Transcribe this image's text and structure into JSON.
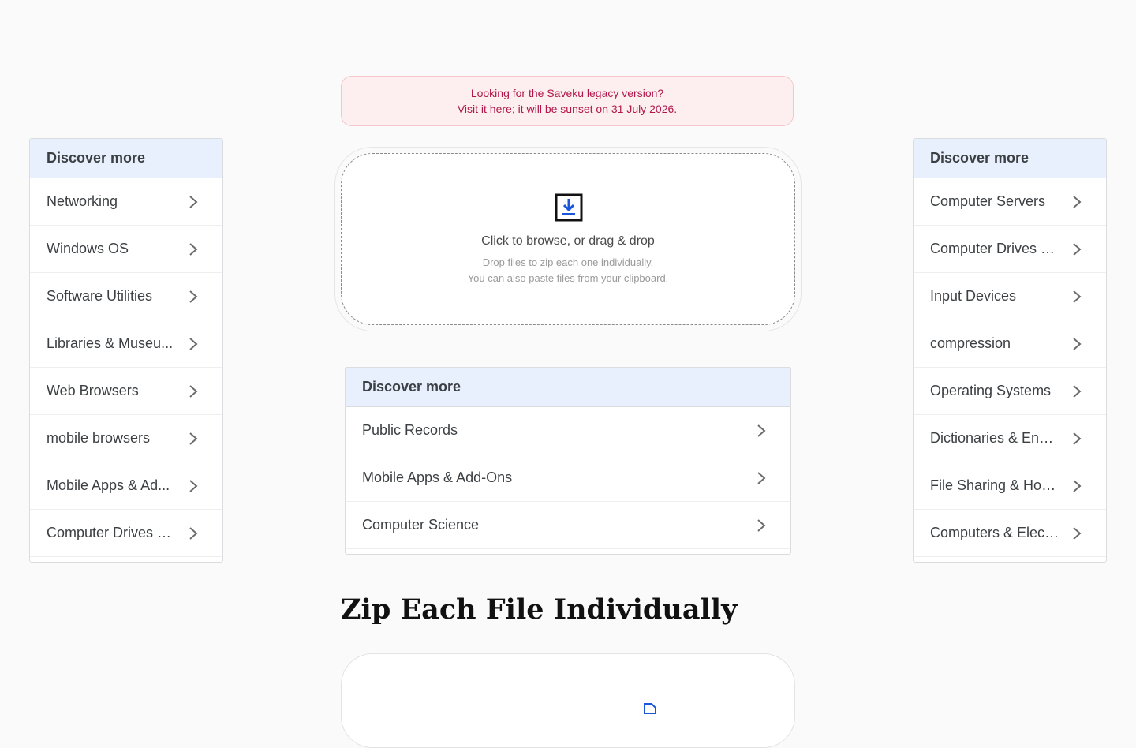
{
  "banner": {
    "line1": "Looking for the Saveku legacy version?",
    "link": "Visit it here",
    "line2_rest": "; it will be sunset on 31 July 2026."
  },
  "dropzone": {
    "title": "Click to browse, or drag & drop",
    "line1": "Drop files to zip each one individually.",
    "line2": "You can also paste files from your clipboard."
  },
  "left_panel": {
    "header": "Discover more",
    "items": [
      {
        "label": "Networking"
      },
      {
        "label": "Windows OS"
      },
      {
        "label": "Software Utilities"
      },
      {
        "label": "Libraries & Museu..."
      },
      {
        "label": "Web Browsers"
      },
      {
        "label": "mobile browsers"
      },
      {
        "label": "Mobile Apps & Ad..."
      },
      {
        "label": "Computer Drives &..."
      }
    ]
  },
  "center_panel": {
    "header": "Discover more",
    "items": [
      {
        "label": "Public Records"
      },
      {
        "label": "Mobile Apps & Add-Ons"
      },
      {
        "label": "Computer Science"
      }
    ]
  },
  "right_panel": {
    "header": "Discover more",
    "items": [
      {
        "label": "Computer Servers"
      },
      {
        "label": "Computer Drives &..."
      },
      {
        "label": "Input Devices"
      },
      {
        "label": "compression"
      },
      {
        "label": "Operating Systems"
      },
      {
        "label": "Dictionaries & Ency..."
      },
      {
        "label": "File Sharing & Host..."
      },
      {
        "label": "Computers & Elect..."
      }
    ]
  },
  "page": {
    "heading": "Zip Each File Individually"
  },
  "icons": {
    "dropzone": "download-tray-icon",
    "chevron": "chevron-right-icon",
    "card": "file-icon"
  },
  "colors": {
    "banner_text": "#b0174a",
    "banner_bg": "#fdeff0",
    "panel_header_bg": "#e8f0fe",
    "icon_blue": "#1a56db"
  }
}
